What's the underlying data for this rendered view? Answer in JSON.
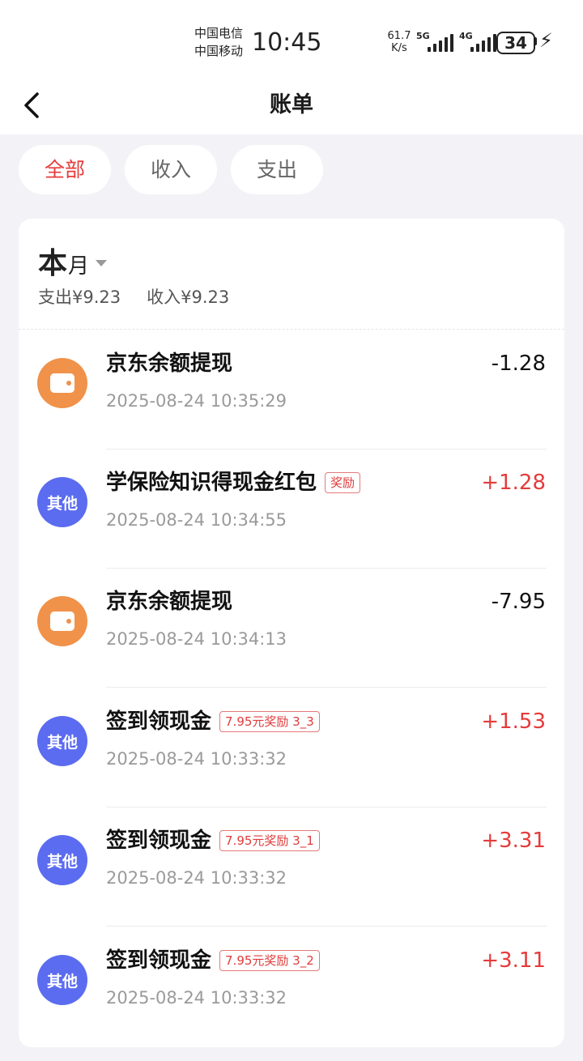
{
  "status_bar": {
    "carrier_top": "中国电信",
    "carrier_bottom": "中国移动",
    "time": "10:45",
    "net_speed_value": "61.7",
    "net_speed_unit": "K/s",
    "sim1_label": "5G",
    "sim2_label": "4G",
    "battery": "34"
  },
  "nav": {
    "title": "账单"
  },
  "filters": [
    {
      "label": "全部",
      "active": true
    },
    {
      "label": "收入",
      "active": false
    },
    {
      "label": "支出",
      "active": false
    }
  ],
  "summary": {
    "month_big": "本",
    "month_small": "月",
    "expense": "支出¥9.23",
    "income": "收入¥9.23"
  },
  "transactions": [
    {
      "icon": "wallet-icon",
      "title": "京东余额提现",
      "tag": "",
      "time": "2025-08-24 10:35:29",
      "amount": "-1.28"
    },
    {
      "icon": "other",
      "icon_text": "其他",
      "title": "学保险知识得现金红包",
      "tag": "奖励",
      "time": "2025-08-24 10:34:55",
      "amount": "+1.28"
    },
    {
      "icon": "wallet-icon",
      "title": "京东余额提现",
      "tag": "",
      "time": "2025-08-24 10:34:13",
      "amount": "-7.95"
    },
    {
      "icon": "other",
      "icon_text": "其他",
      "title": "签到领现金",
      "tag": "7.95元奖励 3_3",
      "time": "2025-08-24 10:33:32",
      "amount": "+1.53"
    },
    {
      "icon": "other",
      "icon_text": "其他",
      "title": "签到领现金",
      "tag": "7.95元奖励 3_1",
      "time": "2025-08-24 10:33:32",
      "amount": "+3.31"
    },
    {
      "icon": "other",
      "icon_text": "其他",
      "title": "签到领现金",
      "tag": "7.95元奖励 3_2",
      "time": "2025-08-24 10:33:32",
      "amount": "+3.11"
    }
  ],
  "colors": {
    "accent_red": "#e53b3b",
    "wallet_orange": "#f0924a",
    "other_blue": "#5b6cf0",
    "page_bg": "#f3f3f7"
  }
}
